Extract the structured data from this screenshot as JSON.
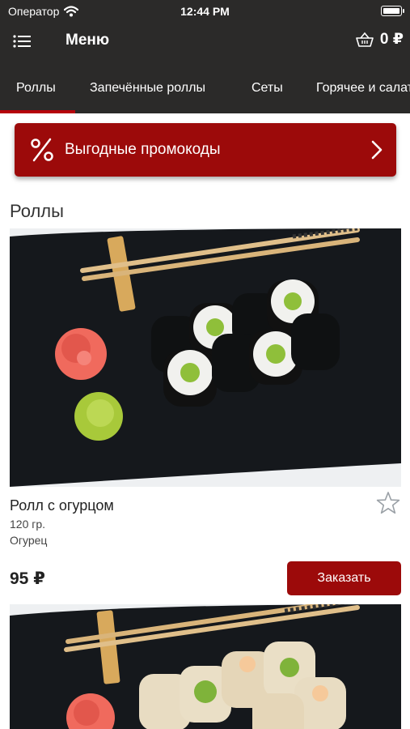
{
  "status_bar": {
    "carrier": "Оператор",
    "time": "12:44 PM"
  },
  "navbar": {
    "title": "Меню",
    "cart_total": "0 ₽"
  },
  "tabs": [
    {
      "label": "Роллы",
      "active": true
    },
    {
      "label": "Запечённые роллы",
      "active": false
    },
    {
      "label": "Сеты",
      "active": false
    },
    {
      "label": "Горячее и салаты",
      "active": false
    }
  ],
  "promo": {
    "label": "Выгодные промокоды"
  },
  "section": {
    "title": "Роллы"
  },
  "products": [
    {
      "name": "Ролл с огурцом",
      "weight": "120 гр.",
      "description": "Огурец",
      "price": "95 ₽",
      "order_label": "Заказать"
    }
  ],
  "colors": {
    "header_bg": "#2b2a29",
    "accent": "#9c0a0a",
    "tab_indicator": "#b5040b"
  },
  "icons": [
    "wifi-icon",
    "battery-icon",
    "menu-list-icon",
    "basket-icon",
    "percent-icon",
    "chevron-right-icon",
    "star-outline-icon"
  ]
}
